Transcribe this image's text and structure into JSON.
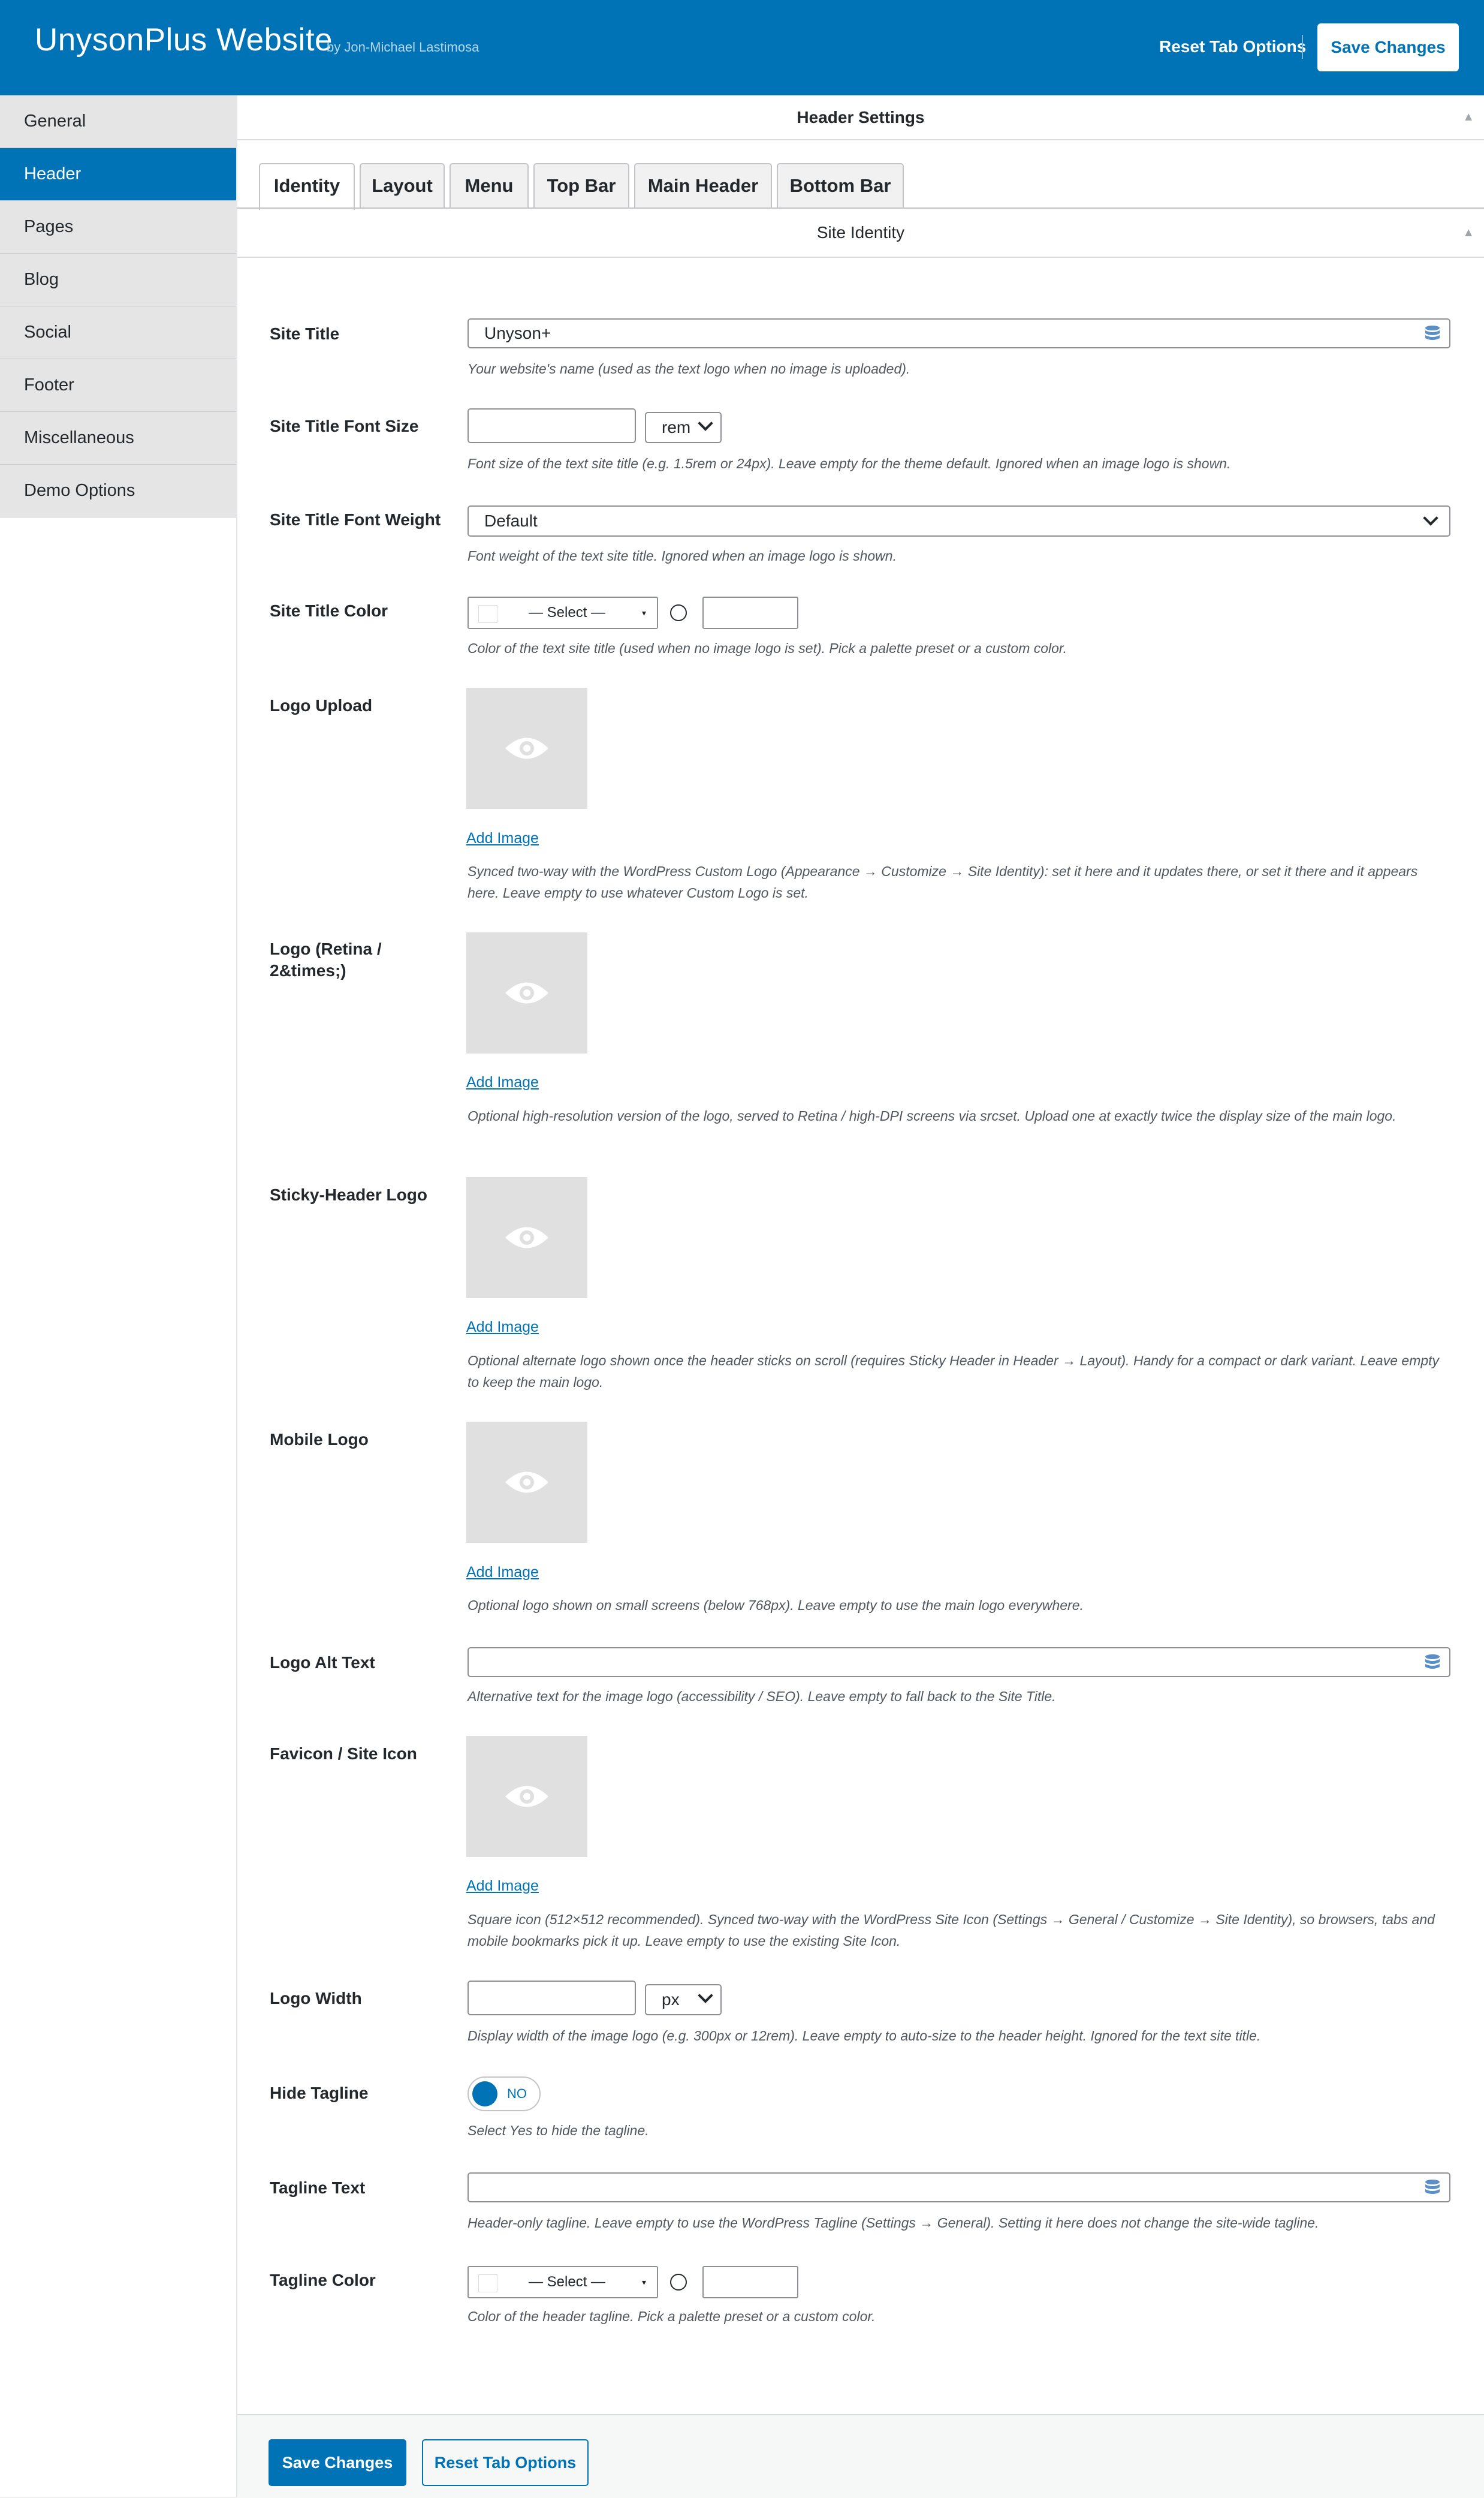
{
  "app": {
    "title": "UnysonPlus Website",
    "byline": "by Jon-Michael Lastimosa",
    "reset_tab_label": "Reset Tab Options",
    "save_label": "Save Changes"
  },
  "sidebar": {
    "items": [
      {
        "label": "General"
      },
      {
        "label": "Header"
      },
      {
        "label": "Pages"
      },
      {
        "label": "Blog"
      },
      {
        "label": "Social"
      },
      {
        "label": "Footer"
      },
      {
        "label": "Miscellaneous"
      },
      {
        "label": "Demo Options"
      }
    ],
    "active": "Header"
  },
  "panel": {
    "title": "Header Settings",
    "tabs": [
      {
        "label": "Identity"
      },
      {
        "label": "Layout"
      },
      {
        "label": "Menu"
      },
      {
        "label": "Top Bar"
      },
      {
        "label": "Main Header"
      },
      {
        "label": "Bottom Bar"
      }
    ],
    "active_tab": "Identity",
    "section_title": "Site Identity"
  },
  "fields": {
    "site_title": {
      "label": "Site Title",
      "value": "Unyson+",
      "desc": "Your website's name (used as the text logo when no image is uploaded)."
    },
    "site_title_font_size": {
      "label": "Site Title Font Size",
      "value": "",
      "unit": "rem",
      "desc": "Font size of the text site title (e.g. 1.5rem or 24px). Leave empty for the theme default. Ignored when an image logo is shown."
    },
    "site_title_font_weight": {
      "label": "Site Title Font Weight",
      "value": "Default",
      "desc": "Font weight of the text site title. Ignored when an image logo is shown."
    },
    "site_title_color": {
      "label": "Site Title Color",
      "select_value": "— Select —",
      "hex": "",
      "desc": "Color of the text site title (used when no image logo is set). Pick a palette preset or a custom color."
    },
    "logo_upload": {
      "label": "Logo Upload",
      "add_label": "Add Image",
      "desc": "Synced two-way with the WordPress Custom Logo (Appearance → Customize → Site Identity): set it here and it updates there, or set it there and it appears here. Leave empty to use whatever Custom Logo is set."
    },
    "logo_retina": {
      "label": "Logo (Retina / 2&times;)",
      "add_label": "Add Image",
      "desc": "Optional high-resolution version of the logo, served to Retina / high-DPI screens via srcset. Upload one at exactly twice the display size of the main logo."
    },
    "sticky_logo": {
      "label": "Sticky-Header Logo",
      "add_label": "Add Image",
      "desc": "Optional alternate logo shown once the header sticks on scroll (requires Sticky Header in Header → Layout). Handy for a compact or dark variant. Leave empty to keep the main logo."
    },
    "mobile_logo": {
      "label": "Mobile Logo",
      "add_label": "Add Image",
      "desc": "Optional logo shown on small screens (below 768px). Leave empty to use the main logo everywhere."
    },
    "logo_alt": {
      "label": "Logo Alt Text",
      "value": "",
      "desc": "Alternative text for the image logo (accessibility / SEO). Leave empty to fall back to the Site Title."
    },
    "favicon": {
      "label": "Favicon / Site Icon",
      "add_label": "Add Image",
      "desc": "Square icon (512×512 recommended). Synced two-way with the WordPress Site Icon (Settings → General / Customize → Site Identity), so browsers, tabs and mobile bookmarks pick it up. Leave empty to use the existing Site Icon."
    },
    "logo_width": {
      "label": "Logo Width",
      "value": "",
      "unit": "px",
      "desc": "Display width of the image logo (e.g. 300px or 12rem). Leave empty to auto-size to the header height. Ignored for the text site title."
    },
    "hide_tagline": {
      "label": "Hide Tagline",
      "toggle_text": "NO",
      "desc": "Select Yes to hide the tagline."
    },
    "tagline_text": {
      "label": "Tagline Text",
      "value": "",
      "desc": "Header-only tagline. Leave empty to use the WordPress Tagline (Settings → General). Setting it here does not change the site-wide tagline."
    },
    "tagline_color": {
      "label": "Tagline Color",
      "select_value": "— Select —",
      "hex": "",
      "desc": "Color of the header tagline. Pick a palette preset or a custom color."
    }
  },
  "footer": {
    "save_label": "Save Changes",
    "reset_label": "Reset Tab Options"
  },
  "colors": {
    "accent": "#0073b7",
    "sidebar_bg": "#e5e5e5",
    "thumb_bg": "#e0e0e0"
  }
}
